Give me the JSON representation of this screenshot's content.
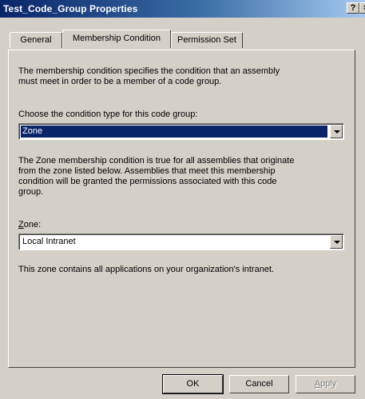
{
  "window": {
    "title": "Test_Code_Group Properties",
    "help_button": "?",
    "close_button": "×"
  },
  "tabs": [
    {
      "label": "General",
      "active": false
    },
    {
      "label": "Membership Condition",
      "active": true
    },
    {
      "label": "Permission Set",
      "active": false
    }
  ],
  "panel": {
    "intro_line1": "The membership condition specifies the condition that an assembly",
    "intro_line2": "must meet in order to be a member of a code group.",
    "condition_label": "Choose the condition type for this code group:",
    "condition_value": "Zone",
    "desc_line1": "The Zone membership condition is true for all assemblies that originate",
    "desc_line2": "from the zone listed below.  Assemblies that meet this membership",
    "desc_line3": "condition will be granted the permissions associated with this code",
    "desc_line4": "group.",
    "zone_label_hotkey": "Z",
    "zone_label_rest": "one:",
    "zone_value": "Local Intranet",
    "zone_info": "This zone contains all applications on your organization's intranet."
  },
  "buttons": {
    "ok": "OK",
    "cancel": "Cancel",
    "apply_hotkey": "A",
    "apply_rest": "pply"
  }
}
